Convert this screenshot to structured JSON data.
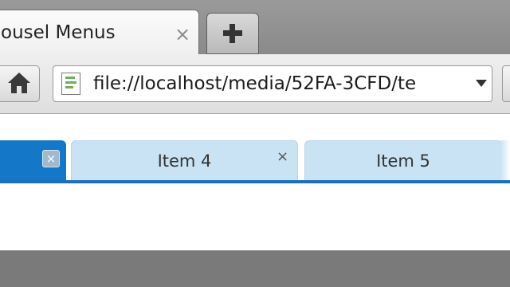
{
  "browser": {
    "tab": {
      "title": "ousel Menus",
      "close_glyph": "×"
    },
    "new_tab": {
      "icon": "plus-icon"
    },
    "nav": {
      "home_icon": "home-icon",
      "url": "file://localhost/media/52FA-3CFD/te",
      "url_dropdown_icon": "chevron-down-icon",
      "page_icon": "page-icon"
    }
  },
  "carousel": {
    "accent_color": "#1477c8",
    "tabs": [
      {
        "label": "",
        "selected": true,
        "close_glyph": "×"
      },
      {
        "label": "Item 4",
        "selected": false,
        "close_glyph": "×"
      },
      {
        "label": "Item 5",
        "selected": false
      }
    ]
  }
}
